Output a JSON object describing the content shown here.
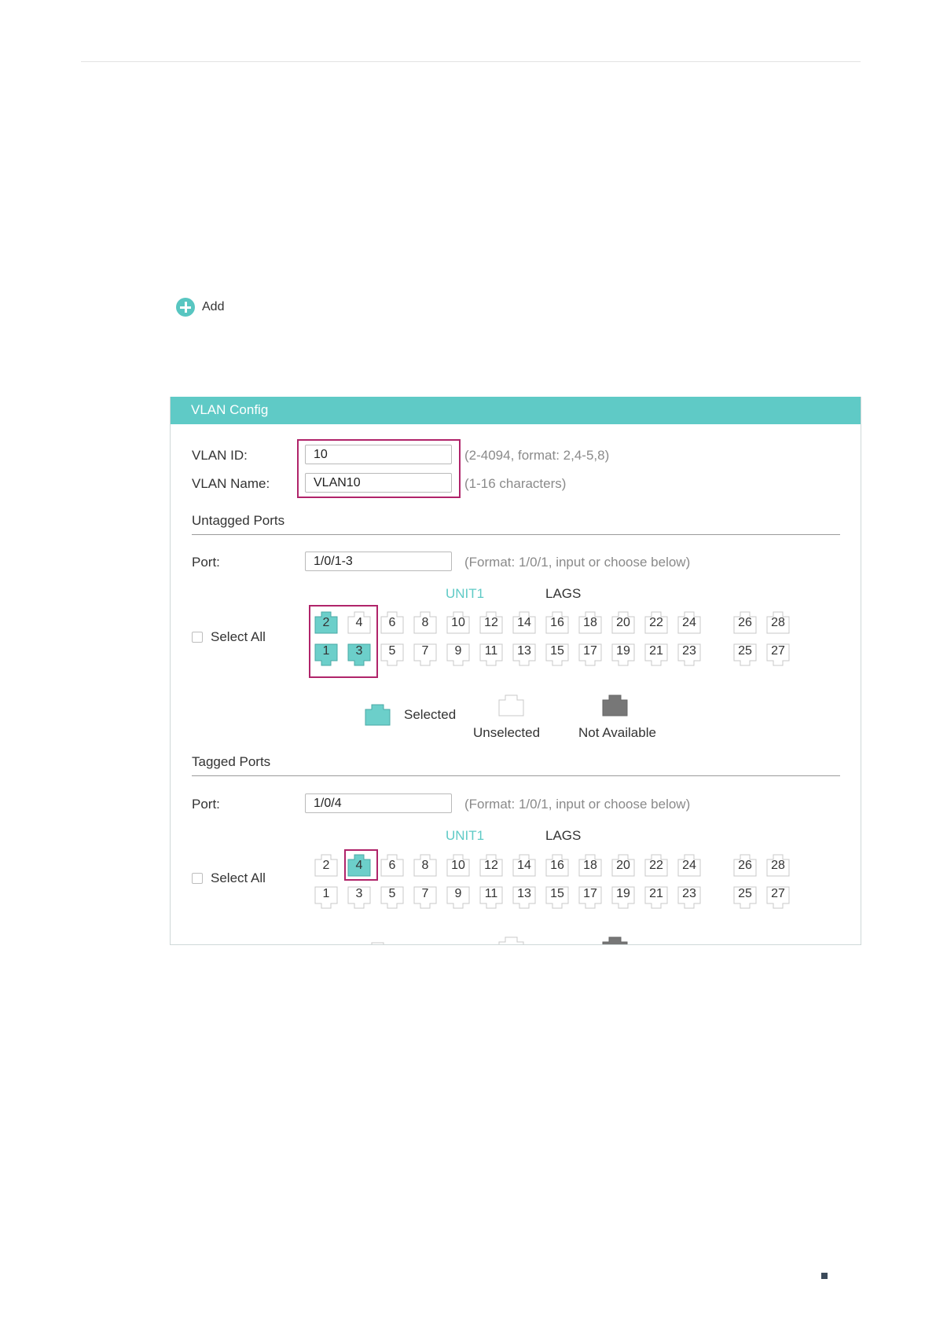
{
  "add": {
    "label": "Add"
  },
  "panel": {
    "title": "VLAN Config",
    "vlan_id": {
      "label": "VLAN ID:",
      "value": "10",
      "hint": "(2-4094, format: 2,4-5,8)"
    },
    "vlan_name": {
      "label": "VLAN Name:",
      "value": "VLAN10",
      "hint": "(1-16 characters)"
    }
  },
  "untagged": {
    "title": "Untagged Ports",
    "port_label": "Port:",
    "port_value": "1/0/1-3",
    "port_hint": "(Format: 1/0/1, input or choose below)",
    "unit_tab": "UNIT1",
    "lags_tab": "LAGS",
    "select_all": "Select All",
    "selected_ports": [
      "1",
      "2",
      "3"
    ]
  },
  "tagged": {
    "title": "Tagged Ports",
    "port_label": "Port:",
    "port_value": "1/0/4",
    "port_hint": "(Format: 1/0/1, input or choose below)",
    "unit_tab": "UNIT1",
    "lags_tab": "LAGS",
    "select_all": "Select All",
    "selected_ports": [
      "4"
    ]
  },
  "ports": {
    "top_row": [
      "2",
      "4",
      "6",
      "8",
      "10",
      "12",
      "14",
      "16",
      "18",
      "20",
      "22",
      "24",
      "26",
      "28"
    ],
    "bottom_row": [
      "1",
      "3",
      "5",
      "7",
      "9",
      "11",
      "13",
      "15",
      "17",
      "19",
      "21",
      "23",
      "25",
      "27"
    ]
  },
  "legend": {
    "selected": "Selected",
    "unselected": "Unselected",
    "not_available": "Not Available"
  },
  "colors": {
    "accent": "#5fcac6",
    "highlight": "#b0246a",
    "not_available": "#777777"
  }
}
